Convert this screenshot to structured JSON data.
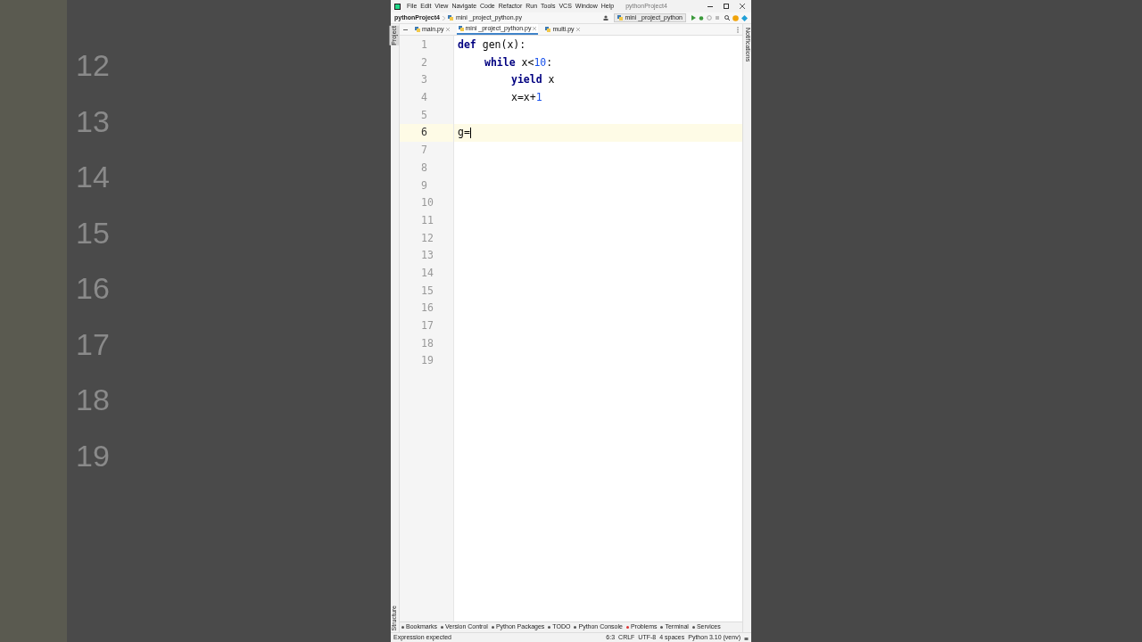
{
  "backdrop_numbers": [
    "12",
    "13",
    "14",
    "15",
    "16",
    "17",
    "18",
    "19"
  ],
  "window": {
    "menu": [
      "File",
      "Edit",
      "View",
      "Navigate",
      "Code",
      "Refactor",
      "Run",
      "Tools",
      "VCS",
      "Window",
      "Help"
    ],
    "title": "pythonProject4"
  },
  "navbar": {
    "breadcrumbs": [
      "pythonProject4",
      "mini _project_python.py"
    ],
    "run_config": "mini _project_python"
  },
  "tabs": [
    {
      "label": "main.py",
      "selected": false
    },
    {
      "label": "mini _project_python.py",
      "selected": true
    },
    {
      "label": "multi.py",
      "selected": false
    }
  ],
  "left_strip": [
    "Project",
    "Structure"
  ],
  "right_strip": "Notifications",
  "editor": {
    "lines": [
      {
        "number": "1",
        "current": false,
        "tokens": [
          {
            "kind": "keyword",
            "text": "def"
          },
          {
            "kind": "plain",
            "text": " gen(x):"
          }
        ],
        "children": [
          {
            "number": "2",
            "current": false,
            "tokens": [
              {
                "kind": "keyword",
                "text": "while"
              },
              {
                "kind": "plain",
                "text": " x<"
              },
              {
                "kind": "number",
                "text": "10"
              },
              {
                "kind": "plain",
                "text": ":"
              }
            ],
            "children": [
              {
                "number": "3",
                "current": false,
                "tokens": [
                  {
                    "kind": "keyword",
                    "text": "yield"
                  },
                  {
                    "kind": "plain",
                    "text": " x"
                  }
                ]
              },
              {
                "number": "4",
                "current": false,
                "tokens": [
                  {
                    "kind": "plain",
                    "text": "x=x+"
                  },
                  {
                    "kind": "number",
                    "text": "1"
                  }
                ]
              }
            ]
          }
        ]
      },
      {
        "number": "5",
        "current": false
      },
      {
        "number": "6",
        "current": true,
        "tokens": [
          {
            "kind": "plain",
            "text": "g="
          }
        ]
      },
      {
        "number": "7",
        "current": false
      },
      {
        "number": "8",
        "current": false
      },
      {
        "number": "9",
        "current": false
      },
      {
        "number": "10",
        "current": false
      },
      {
        "number": "11",
        "current": false
      },
      {
        "number": "12",
        "current": false
      },
      {
        "number": "13",
        "current": false
      },
      {
        "number": "14",
        "current": false
      },
      {
        "number": "15",
        "current": false
      },
      {
        "number": "16",
        "current": false
      },
      {
        "number": "17",
        "current": false
      },
      {
        "number": "18",
        "current": false
      },
      {
        "number": "19",
        "current": false
      }
    ]
  },
  "tool_windows": [
    "Bookmarks",
    "Version Control",
    "Python Packages",
    "TODO",
    "Python Console",
    "Problems",
    "Terminal",
    "Services"
  ],
  "status_bar": {
    "message": "Expression expected",
    "items": [
      "6:3",
      "CRLF",
      "UTF-8",
      "4 spaces",
      "Python 3.10 (venv)"
    ]
  }
}
